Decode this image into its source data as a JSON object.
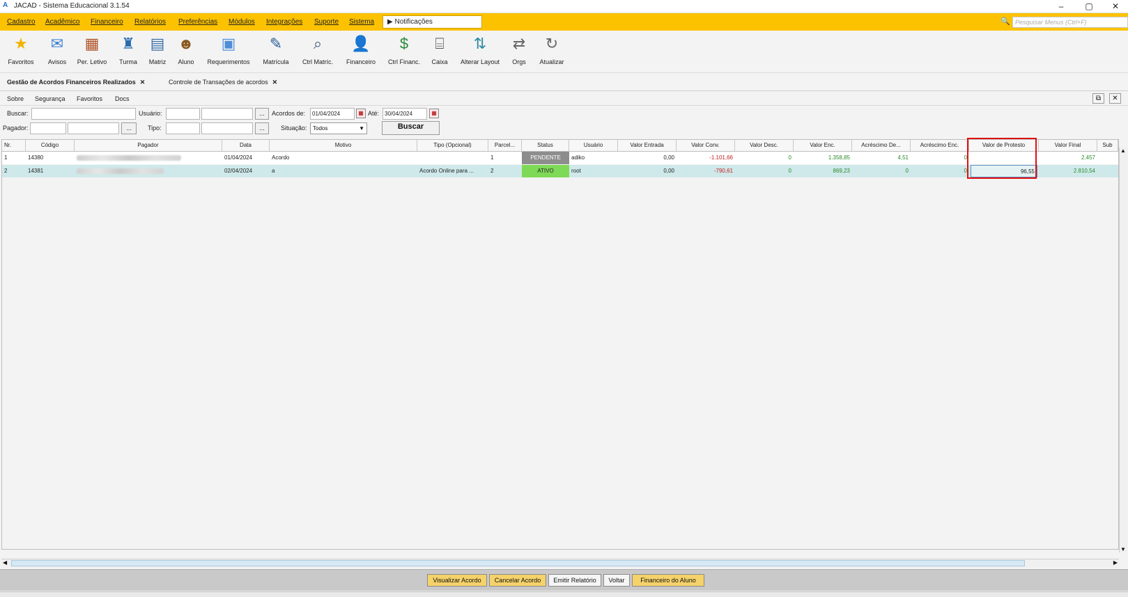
{
  "window": {
    "title": "JACAD - Sistema Educacional 3.1.54",
    "minimize": "–",
    "maximize": "▢",
    "close": "✕"
  },
  "menubar": {
    "items": [
      "Cadastro",
      "Acadêmico",
      "Financeiro",
      "Relatórios",
      "Preferências",
      "Módulos",
      "Integrações",
      "Suporte",
      "Sistema"
    ],
    "notifications_tab": "Notificações",
    "search_placeholder": "Pesquisar Menus (Ctrl+F)"
  },
  "toolbar": {
    "items": [
      {
        "label": "Favoritos",
        "icon": "star-icon"
      },
      {
        "label": "Avisos",
        "icon": "mail-icon"
      },
      {
        "label": "Per. Letivo",
        "icon": "calendar-icon"
      },
      {
        "label": "Turma",
        "icon": "class-icon"
      },
      {
        "label": "Matriz",
        "icon": "matrix-icon"
      },
      {
        "label": "Aluno",
        "icon": "student-icon"
      },
      {
        "label": "Requerimentos",
        "icon": "requests-icon"
      },
      {
        "label": "Matrícula",
        "icon": "enrollment-icon"
      },
      {
        "label": "Ctrl Matríc.",
        "icon": "search-doc-icon"
      },
      {
        "label": "Financeiro",
        "icon": "finance-user-icon"
      },
      {
        "label": "Ctrl Financ.",
        "icon": "money-icon"
      },
      {
        "label": "Caixa",
        "icon": "cash-register-icon"
      },
      {
        "label": "Alterar Layout",
        "icon": "layout-icon"
      },
      {
        "label": "Orgs",
        "icon": "swap-icon"
      },
      {
        "label": "Atualizar",
        "icon": "refresh-icon"
      }
    ]
  },
  "tabs": [
    {
      "label": "Gestão de Acordos Financeiros Realizados",
      "close": "✕"
    },
    {
      "label": "Controle de Transações de acordos",
      "close": "✕"
    }
  ],
  "submenu": {
    "items": [
      "Sobre",
      "Segurança",
      "Favoritos",
      "Docs"
    ]
  },
  "filters": {
    "buscar_label": "Buscar:",
    "usuario_label": "Usuário:",
    "acordos_de_label": "Acordos de:",
    "acordos_de_value": "01/04/2024",
    "ate_label": "Até:",
    "ate_value": "30/04/2024",
    "pagador_label": "Pagador:",
    "tipo_label": "Tipo:",
    "situacao_label": "Situação:",
    "situacao_value": "Todos",
    "ellipsis": "...",
    "buscar_button": "Buscar"
  },
  "table": {
    "columns": [
      "Nr.",
      "Código",
      "Pagador",
      "Data",
      "Motivo",
      "Tipo (Opcional)",
      "Parcel...",
      "Status",
      "Usuário",
      "Valor Entrada",
      "Valor Conv.",
      "Valor Desc.",
      "Valor Enc.",
      "Acréscimo De...",
      "Acréscimo Enc.",
      "Valor de Protesto",
      "Valor Final",
      "Sub"
    ],
    "rows": [
      {
        "nr": "1",
        "codigo": "14380",
        "data": "01/04/2024",
        "motivo": "Acordo",
        "tipo": "",
        "parcel": "1",
        "status": "PENDENTE",
        "usuario": "adiko",
        "valor_entrada": "0,00",
        "valor_conv": "-1.101,66",
        "valor_desc": "0",
        "valor_enc": "1.358,85",
        "acrescimo_de": "4,51",
        "acrescimo_enc": "0",
        "valor_protesto": "",
        "valor_final": "2.457"
      },
      {
        "nr": "2",
        "codigo": "14381",
        "data": "02/04/2024",
        "motivo": "a",
        "tipo": "Acordo Online para ...",
        "parcel": "2",
        "status": "ATIVO",
        "usuario": "root",
        "valor_entrada": "0,00",
        "valor_conv": "-790,61",
        "valor_desc": "0",
        "valor_enc": "869,23",
        "acrescimo_de": "0",
        "acrescimo_enc": "0",
        "valor_protesto": "96,55",
        "valor_final": "2.810,54"
      }
    ]
  },
  "bottom_buttons": [
    "Visualizar Acordo",
    "Cancelar Acordo",
    "Emitir Relatório",
    "Voltar",
    "Financeiro do Aluno"
  ],
  "colors": {
    "menubar": "#fcc200",
    "pendente": "#8d8d8d",
    "ativo": "#7ed957",
    "highlight": "#e01010",
    "selected_row": "#cfe9ea"
  }
}
